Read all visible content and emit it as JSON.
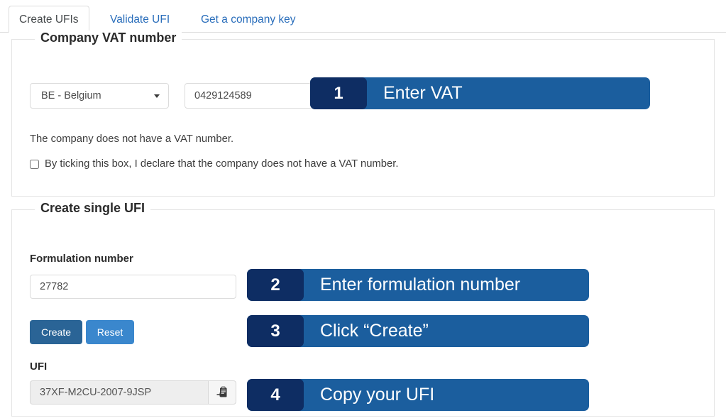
{
  "tabs": [
    {
      "label": "Create UFIs",
      "active": true
    },
    {
      "label": "Validate UFI",
      "active": false
    },
    {
      "label": "Get a company key",
      "active": false
    }
  ],
  "vat_panel": {
    "legend": "Company VAT number",
    "country_select": {
      "value": "BE - Belgium",
      "caret_icon": "chevron-down-icon"
    },
    "vat_input": {
      "value": "0429124589",
      "placeholder": ""
    },
    "no_vat_text": "The company does not have a VAT number.",
    "no_vat_checkbox_label": "By ticking this box, I declare that the company does not have a VAT number.",
    "no_vat_checked": false
  },
  "single_ufi_panel": {
    "legend": "Create single UFI",
    "formulation_label": "Formulation number",
    "formulation_input": {
      "value": "27782",
      "placeholder": ""
    },
    "create_button": "Create",
    "reset_button": "Reset",
    "ufi_label": "UFI",
    "ufi_output": {
      "value": "37XF-M2CU-2007-9JSP",
      "placeholder": ""
    },
    "copy_icon": "clipboard-copy-icon"
  },
  "steps": [
    {
      "number": "1",
      "text": "Enter VAT"
    },
    {
      "number": "2",
      "text": "Enter formulation number"
    },
    {
      "number": "3",
      "text": "Click “Create”"
    },
    {
      "number": "4",
      "text": "Copy your UFI"
    }
  ],
  "colors": {
    "banner_body": "#1b5e9e",
    "banner_badge": "#0e2d63",
    "tab_link": "#2a6ebb",
    "create_button": "#2a6496",
    "reset_button": "#3a87cd"
  }
}
